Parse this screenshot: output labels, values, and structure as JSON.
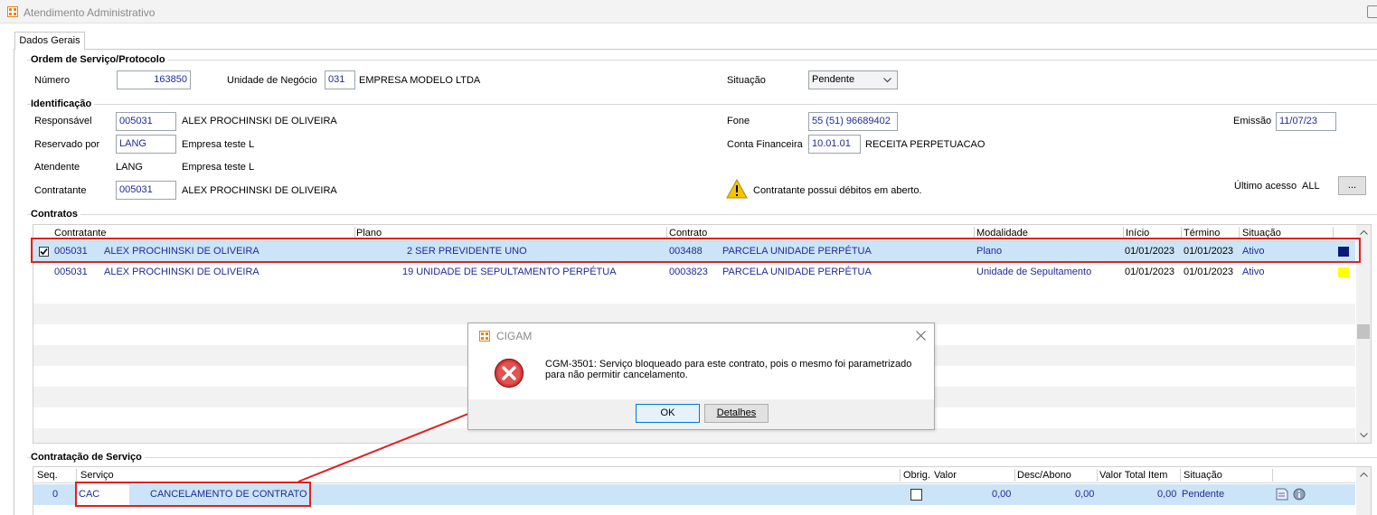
{
  "window": {
    "title": "Atendimento Administrativo"
  },
  "tabs": [
    {
      "label": "Dados Gerais"
    }
  ],
  "ordem": {
    "title": "Ordem de Serviço/Protocolo",
    "numero_label": "Número",
    "numero_value": "163850",
    "unidade_label": "Unidade de Negócio",
    "unidade_code": "031",
    "unidade_name": "EMPRESA MODELO LTDA",
    "situacao_label": "Situação",
    "situacao_value": "Pendente"
  },
  "identificacao": {
    "title": "Identificação",
    "responsavel_label": "Responsável",
    "responsavel_code": "005031",
    "responsavel_name": "ALEX PROCHINSKI DE OLIVEIRA",
    "reservado_label": "Reservado por",
    "reservado_code": "LANG",
    "reservado_name": "Empresa teste L",
    "atendente_label": "Atendente",
    "atendente_code": "LANG",
    "atendente_name": "Empresa teste L",
    "contratante_label": "Contratante",
    "contratante_code": "005031",
    "contratante_name": "ALEX PROCHINSKI DE OLIVEIRA",
    "fone_label": "Fone",
    "fone_value": "55 (51) 96689402",
    "conta_label": "Conta Financeira",
    "conta_code": "10.01.01",
    "conta_name": "RECEITA PERPETUACAO",
    "warning_text": "Contratante possui débitos em aberto.",
    "emissao_label": "Emissão",
    "emissao_value": "11/07/23",
    "ultimo_label": "Último acesso",
    "ultimo_value": "ALL",
    "more_button": "..."
  },
  "contratos": {
    "title": "Contratos",
    "headers": [
      "Contratante",
      "Plano",
      "Contrato",
      "Modalidade",
      "Início",
      "Término",
      "Situação"
    ],
    "rows": [
      {
        "code": "005031",
        "name": "ALEX PROCHINSKI DE OLIVEIRA",
        "plano": "2 SER PREVIDENTE UNO",
        "contrato_code": "003488",
        "contrato_name": "PARCELA UNIDADE PERPÉTUA",
        "modalidade": "Plano",
        "inicio": "01/01/2023",
        "termino": "01/01/2023",
        "situacao": "Ativo",
        "color": "#0a1a7a",
        "checked": true
      },
      {
        "code": "005031",
        "name": "ALEX PROCHINSKI DE OLIVEIRA",
        "plano": "19 UNIDADE DE SEPULTAMENTO PERPÉTUA",
        "contrato_code": "0003823",
        "contrato_name": "PARCELA UNIDADE PERPÉTUA",
        "modalidade": "Unidade de Sepultamento",
        "inicio": "01/01/2023",
        "termino": "01/01/2023",
        "situacao": "Ativo",
        "color": "#ffff00",
        "checked": false
      }
    ]
  },
  "servico": {
    "title": "Contratação de Serviço",
    "headers": [
      "Seq.",
      "Serviço",
      "Obrig.",
      "Valor",
      "Desc/Abono",
      "Valor Total Item",
      "Situação"
    ],
    "row": {
      "seq": "0",
      "code": "CAC",
      "name": "CANCELAMENTO DE CONTRATO",
      "valor": "0,00",
      "desc": "0,00",
      "total": "0,00",
      "situacao": "Pendente"
    }
  },
  "dialog": {
    "title": "CIGAM",
    "message_line1": "CGM-3501: Serviço bloqueado para este contrato, pois o mesmo foi parametrizado",
    "message_line2": "para não permitir cancelamento.",
    "ok_label": "OK",
    "details_label": "Detalhes"
  },
  "colors": {
    "selected_row": "#cce4f7",
    "annotation": "#e02020",
    "text_blue": "#1f2a9a"
  }
}
